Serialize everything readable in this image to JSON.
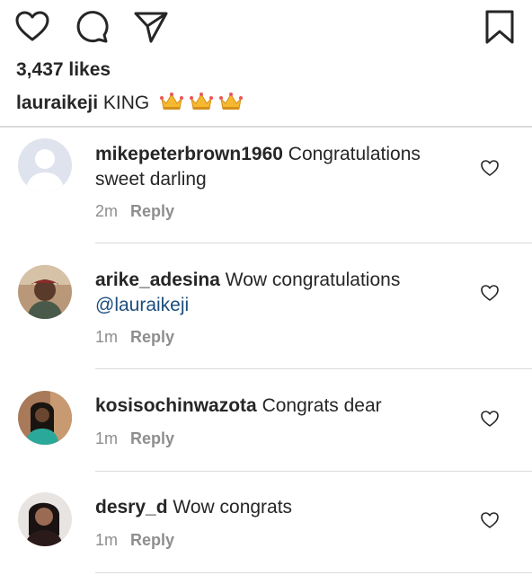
{
  "post": {
    "likes_text": "3,437 likes",
    "caption_user": "lauraikeji",
    "caption_text": "KING",
    "caption_emoji": "crown-emoji",
    "caption_emoji_count": 3
  },
  "icons": {
    "like": "heart-icon",
    "comment": "speech-bubble-icon",
    "share": "paper-plane-icon",
    "save": "bookmark-icon",
    "comment_like": "small-heart-icon"
  },
  "colors": {
    "text": "#262626",
    "muted": "#8e8e8e",
    "mention": "#1c4d7e",
    "divider": "#dbdbdb"
  },
  "comments": [
    {
      "user": "mikepeterbrown1960",
      "text": "Congratulations sweet darling",
      "mention": "",
      "time": "2m",
      "reply": "Reply"
    },
    {
      "user": "arike_adesina",
      "text": "Wow congratulations",
      "mention": "@lauraikeji",
      "time": "1m",
      "reply": "Reply"
    },
    {
      "user": "kosisochinwazota",
      "text": "Congrats dear",
      "mention": "",
      "time": "1m",
      "reply": "Reply"
    },
    {
      "user": "desry_d",
      "text": "Wow congrats",
      "mention": "",
      "time": "1m",
      "reply": "Reply"
    }
  ]
}
